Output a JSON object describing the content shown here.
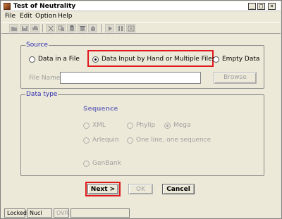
{
  "window": {
    "title": "Test of Neutrality",
    "min_label": "_",
    "max_label": "□",
    "close_label": "×"
  },
  "menu": [
    "File",
    "Edit",
    "Option",
    "Help"
  ],
  "source": {
    "label": "Source",
    "options": [
      {
        "label": "Data in a File",
        "checked": false
      },
      {
        "label": "Data Input by Hand or Multiple Files",
        "checked": true
      },
      {
        "label": "Empty Data",
        "checked": false
      }
    ],
    "file_name_label": "File Name",
    "file_name_value": "",
    "browse_label": "Browse"
  },
  "data_type": {
    "label": "Data type",
    "heading": "Sequence",
    "formats": [
      {
        "label": "XML",
        "checked": false
      },
      {
        "label": "Phylip",
        "checked": false
      },
      {
        "label": "Mega",
        "checked": true
      },
      {
        "label": "Arlequin",
        "checked": false
      },
      {
        "label": "One line, one sequence",
        "checked": false
      },
      {
        "label": "GenBank",
        "checked": false
      }
    ]
  },
  "buttons": {
    "next": "Next >",
    "ok": "OK",
    "cancel": "Cancel"
  },
  "status": [
    "Locked",
    "Nucl",
    "OVR",
    ""
  ],
  "colors": {
    "highlight": "#e0181e",
    "group_label": "#2a2ab0",
    "background": "#ece9d8"
  }
}
